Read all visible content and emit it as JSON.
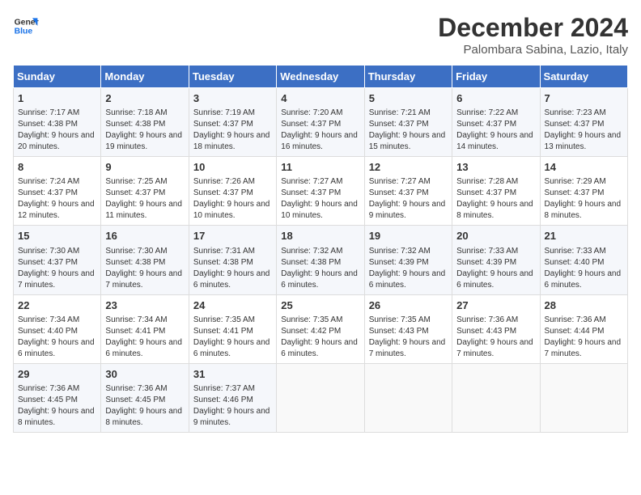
{
  "logo": {
    "line1": "General",
    "line2": "Blue"
  },
  "title": "December 2024",
  "subtitle": "Palombara Sabina, Lazio, Italy",
  "days_header": [
    "Sunday",
    "Monday",
    "Tuesday",
    "Wednesday",
    "Thursday",
    "Friday",
    "Saturday"
  ],
  "weeks": [
    [
      {
        "day": "1",
        "info": "Sunrise: 7:17 AM\nSunset: 4:38 PM\nDaylight: 9 hours and 20 minutes."
      },
      {
        "day": "2",
        "info": "Sunrise: 7:18 AM\nSunset: 4:38 PM\nDaylight: 9 hours and 19 minutes."
      },
      {
        "day": "3",
        "info": "Sunrise: 7:19 AM\nSunset: 4:37 PM\nDaylight: 9 hours and 18 minutes."
      },
      {
        "day": "4",
        "info": "Sunrise: 7:20 AM\nSunset: 4:37 PM\nDaylight: 9 hours and 16 minutes."
      },
      {
        "day": "5",
        "info": "Sunrise: 7:21 AM\nSunset: 4:37 PM\nDaylight: 9 hours and 15 minutes."
      },
      {
        "day": "6",
        "info": "Sunrise: 7:22 AM\nSunset: 4:37 PM\nDaylight: 9 hours and 14 minutes."
      },
      {
        "day": "7",
        "info": "Sunrise: 7:23 AM\nSunset: 4:37 PM\nDaylight: 9 hours and 13 minutes."
      }
    ],
    [
      {
        "day": "8",
        "info": "Sunrise: 7:24 AM\nSunset: 4:37 PM\nDaylight: 9 hours and 12 minutes."
      },
      {
        "day": "9",
        "info": "Sunrise: 7:25 AM\nSunset: 4:37 PM\nDaylight: 9 hours and 11 minutes."
      },
      {
        "day": "10",
        "info": "Sunrise: 7:26 AM\nSunset: 4:37 PM\nDaylight: 9 hours and 10 minutes."
      },
      {
        "day": "11",
        "info": "Sunrise: 7:27 AM\nSunset: 4:37 PM\nDaylight: 9 hours and 10 minutes."
      },
      {
        "day": "12",
        "info": "Sunrise: 7:27 AM\nSunset: 4:37 PM\nDaylight: 9 hours and 9 minutes."
      },
      {
        "day": "13",
        "info": "Sunrise: 7:28 AM\nSunset: 4:37 PM\nDaylight: 9 hours and 8 minutes."
      },
      {
        "day": "14",
        "info": "Sunrise: 7:29 AM\nSunset: 4:37 PM\nDaylight: 9 hours and 8 minutes."
      }
    ],
    [
      {
        "day": "15",
        "info": "Sunrise: 7:30 AM\nSunset: 4:37 PM\nDaylight: 9 hours and 7 minutes."
      },
      {
        "day": "16",
        "info": "Sunrise: 7:30 AM\nSunset: 4:38 PM\nDaylight: 9 hours and 7 minutes."
      },
      {
        "day": "17",
        "info": "Sunrise: 7:31 AM\nSunset: 4:38 PM\nDaylight: 9 hours and 6 minutes."
      },
      {
        "day": "18",
        "info": "Sunrise: 7:32 AM\nSunset: 4:38 PM\nDaylight: 9 hours and 6 minutes."
      },
      {
        "day": "19",
        "info": "Sunrise: 7:32 AM\nSunset: 4:39 PM\nDaylight: 9 hours and 6 minutes."
      },
      {
        "day": "20",
        "info": "Sunrise: 7:33 AM\nSunset: 4:39 PM\nDaylight: 9 hours and 6 minutes."
      },
      {
        "day": "21",
        "info": "Sunrise: 7:33 AM\nSunset: 4:40 PM\nDaylight: 9 hours and 6 minutes."
      }
    ],
    [
      {
        "day": "22",
        "info": "Sunrise: 7:34 AM\nSunset: 4:40 PM\nDaylight: 9 hours and 6 minutes."
      },
      {
        "day": "23",
        "info": "Sunrise: 7:34 AM\nSunset: 4:41 PM\nDaylight: 9 hours and 6 minutes."
      },
      {
        "day": "24",
        "info": "Sunrise: 7:35 AM\nSunset: 4:41 PM\nDaylight: 9 hours and 6 minutes."
      },
      {
        "day": "25",
        "info": "Sunrise: 7:35 AM\nSunset: 4:42 PM\nDaylight: 9 hours and 6 minutes."
      },
      {
        "day": "26",
        "info": "Sunrise: 7:35 AM\nSunset: 4:43 PM\nDaylight: 9 hours and 7 minutes."
      },
      {
        "day": "27",
        "info": "Sunrise: 7:36 AM\nSunset: 4:43 PM\nDaylight: 9 hours and 7 minutes."
      },
      {
        "day": "28",
        "info": "Sunrise: 7:36 AM\nSunset: 4:44 PM\nDaylight: 9 hours and 7 minutes."
      }
    ],
    [
      {
        "day": "29",
        "info": "Sunrise: 7:36 AM\nSunset: 4:45 PM\nDaylight: 9 hours and 8 minutes."
      },
      {
        "day": "30",
        "info": "Sunrise: 7:36 AM\nSunset: 4:45 PM\nDaylight: 9 hours and 8 minutes."
      },
      {
        "day": "31",
        "info": "Sunrise: 7:37 AM\nSunset: 4:46 PM\nDaylight: 9 hours and 9 minutes."
      },
      {
        "day": "",
        "info": ""
      },
      {
        "day": "",
        "info": ""
      },
      {
        "day": "",
        "info": ""
      },
      {
        "day": "",
        "info": ""
      }
    ]
  ]
}
